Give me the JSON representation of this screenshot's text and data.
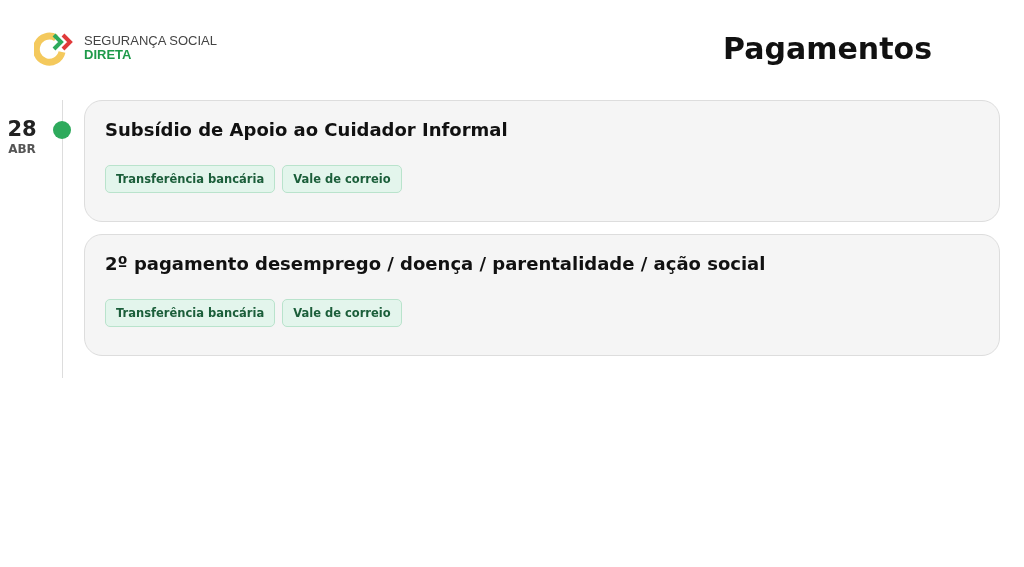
{
  "logo": {
    "line1": "SEGURANÇA SOCIAL",
    "line2": "DIRETA"
  },
  "title": "Pagamentos",
  "days": [
    {
      "day": "28",
      "month": "ABR",
      "color": "#2eaa5c",
      "payments": [
        {
          "name": "Subsídio de Apoio ao Cuidador Informal",
          "methods": [
            "Transferência bancária",
            "Vale de correio"
          ]
        },
        {
          "name": "2º pagamento desemprego / doença / parentalidade / ação social",
          "methods": [
            "Transferência bancária",
            "Vale de correio"
          ]
        }
      ]
    }
  ]
}
